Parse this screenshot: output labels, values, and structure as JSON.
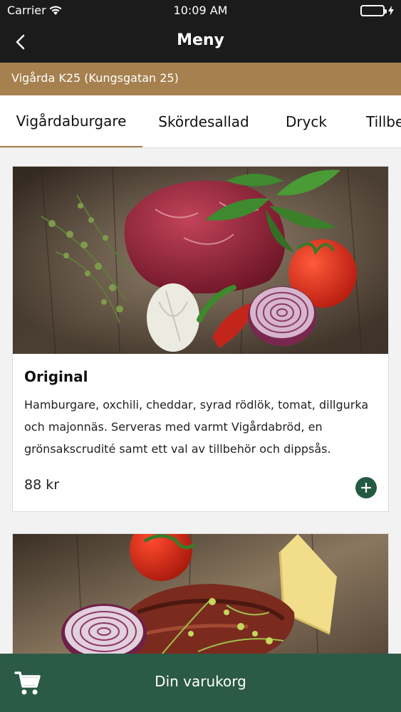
{
  "status_bar": {
    "carrier": "Carrier",
    "time": "10:09 AM"
  },
  "nav": {
    "title": "Meny"
  },
  "location": {
    "label": "Vigårda K25 (Kungsgatan 25)"
  },
  "tabs": [
    {
      "label": "Vigårdaburgare",
      "active": true
    },
    {
      "label": "Skördesallad",
      "active": false
    },
    {
      "label": "Dryck",
      "active": false
    },
    {
      "label": "Tillbehör",
      "active": false
    }
  ],
  "menu_items": [
    {
      "name": "Original",
      "description": "Hamburgare, oxchili, cheddar, syrad rödlök, tomat, dillgurka och majonnäs. Serveras med varmt Vigårdabröd, en grönsakscrudité samt ett val av tillbehör och dippsås.",
      "price": "88 kr"
    }
  ],
  "cart": {
    "label": "Din varukorg"
  },
  "colors": {
    "header_bg": "#1b1b1b",
    "location_bg": "#a6804e",
    "accent_green": "#235a44",
    "cart_bg": "#2b5a47"
  }
}
